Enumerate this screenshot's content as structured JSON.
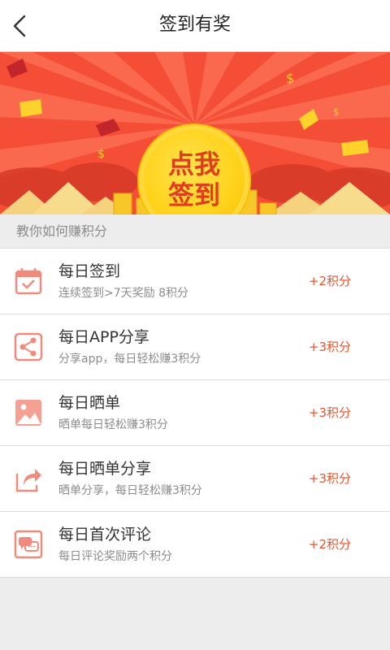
{
  "header": {
    "title": "签到有奖",
    "back_icon": "chevron-left-icon"
  },
  "banner": {
    "button_line1": "点我",
    "button_line2": "签到",
    "colors": {
      "background": "#f6563c",
      "ray": "#ff8a6b",
      "coin": "#ffd21a",
      "text": "#e03c1e"
    }
  },
  "section": {
    "title": "教你如何赚积分"
  },
  "tasks": [
    {
      "icon": "calendar-check-icon",
      "name": "每日签到",
      "desc": "连续签到>7天奖励 8积分",
      "points": "+2积分"
    },
    {
      "icon": "share-icon",
      "name": "每日APP分享",
      "desc": "分享app，每日轻松赚3积分",
      "points": "+3积分"
    },
    {
      "icon": "image-icon",
      "name": "每日晒单",
      "desc": "晒单每日轻松赚3积分",
      "points": "+3积分"
    },
    {
      "icon": "forward-arrow-icon",
      "name": "每日晒单分享",
      "desc": "晒单分享，每日轻松赚3积分",
      "points": "+3积分"
    },
    {
      "icon": "chat-bubbles-icon",
      "name": "每日首次评论",
      "desc": "每日评论奖励两个积分",
      "points": "+2积分"
    }
  ],
  "accent_color": "#e8542a",
  "icon_color": "#f08a7a"
}
